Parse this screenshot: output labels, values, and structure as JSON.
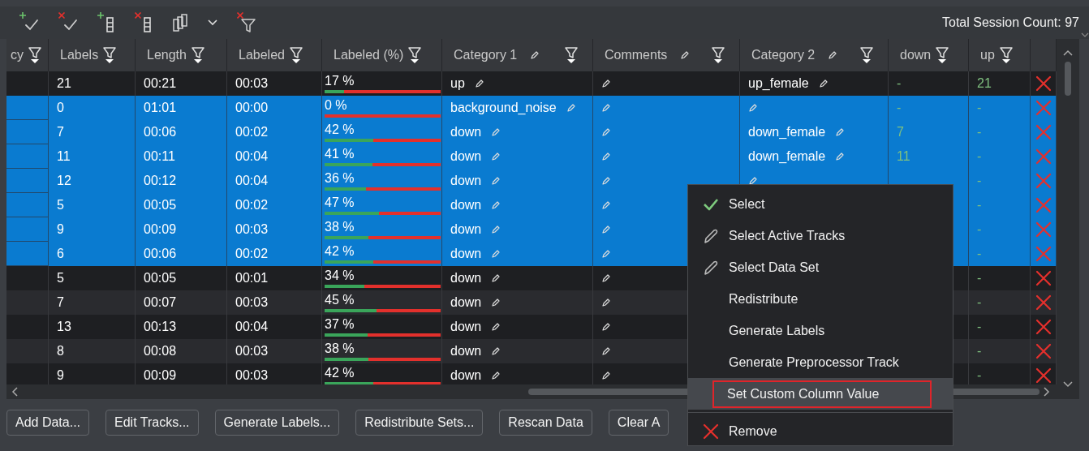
{
  "toolbar": {
    "session_count": "Total Session Count: 97"
  },
  "table": {
    "columns": [
      {
        "label": "cy",
        "kind": "text",
        "editable": false
      },
      {
        "label": "Labels",
        "kind": "text",
        "editable": false
      },
      {
        "label": "Length",
        "kind": "text",
        "editable": false
      },
      {
        "label": "Labeled",
        "kind": "text",
        "editable": false
      },
      {
        "label": "Labeled (%)",
        "kind": "progress",
        "editable": false
      },
      {
        "label": "Category 1",
        "kind": "text",
        "editable": true
      },
      {
        "label": "Comments",
        "kind": "text",
        "editable": true
      },
      {
        "label": "Category 2",
        "kind": "text",
        "editable": true
      },
      {
        "label": "down",
        "kind": "count",
        "editable": false
      },
      {
        "label": "up",
        "kind": "count",
        "editable": false
      }
    ],
    "rows": [
      {
        "selected": false,
        "cells": [
          null,
          "21",
          "00:21",
          "00:03",
          {
            "text": "17 %",
            "level": 0.17
          },
          "up",
          null,
          "up_female",
          "-",
          "21"
        ]
      },
      {
        "selected": true,
        "cells": [
          null,
          "0",
          "01:01",
          "00:00",
          {
            "text": "0 %",
            "level": 0
          },
          "background_noise",
          null,
          null,
          "-",
          "-"
        ]
      },
      {
        "selected": true,
        "cells": [
          null,
          "7",
          "00:06",
          "00:02",
          {
            "text": "42 %",
            "level": 0.42
          },
          "down",
          null,
          "down_female",
          "7",
          "-"
        ]
      },
      {
        "selected": true,
        "cells": [
          null,
          "11",
          "00:11",
          "00:04",
          {
            "text": "41 %",
            "level": 0.41
          },
          "down",
          null,
          "down_female",
          "11",
          "-"
        ]
      },
      {
        "selected": true,
        "cells": [
          null,
          "12",
          "00:12",
          "00:04",
          {
            "text": "36 %",
            "level": 0.36
          },
          "down",
          null,
          null,
          null,
          "-"
        ]
      },
      {
        "selected": true,
        "cells": [
          null,
          "5",
          "00:05",
          "00:02",
          {
            "text": "47 %",
            "level": 0.47
          },
          "down",
          null,
          null,
          null,
          "-"
        ]
      },
      {
        "selected": true,
        "cells": [
          null,
          "9",
          "00:09",
          "00:03",
          {
            "text": "38 %",
            "level": 0.38
          },
          "down",
          null,
          null,
          null,
          "-"
        ]
      },
      {
        "selected": true,
        "cells": [
          null,
          "6",
          "00:06",
          "00:02",
          {
            "text": "42 %",
            "level": 0.42
          },
          "down",
          null,
          null,
          null,
          "-"
        ]
      },
      {
        "selected": false,
        "cells": [
          null,
          "5",
          "00:05",
          "00:01",
          {
            "text": "34 %",
            "level": 0.34
          },
          "down",
          null,
          null,
          null,
          "-"
        ]
      },
      {
        "selected": false,
        "cells": [
          null,
          "7",
          "00:07",
          "00:03",
          {
            "text": "45 %",
            "level": 0.45
          },
          "down",
          null,
          null,
          null,
          "-"
        ]
      },
      {
        "selected": false,
        "cells": [
          null,
          "13",
          "00:13",
          "00:04",
          {
            "text": "37 %",
            "level": 0.37
          },
          "down",
          null,
          null,
          null,
          "-"
        ]
      },
      {
        "selected": false,
        "cells": [
          null,
          "8",
          "00:08",
          "00:03",
          {
            "text": "38 %",
            "level": 0.38
          },
          "down",
          null,
          null,
          null,
          "-"
        ]
      },
      {
        "selected": false,
        "cells": [
          null,
          "9",
          "00:09",
          "00:03",
          {
            "text": "42 %",
            "level": 0.42
          },
          "down",
          null,
          null,
          null,
          "-"
        ]
      }
    ]
  },
  "buttons": [
    "Add Data...",
    "Edit Tracks...",
    "Generate Labels...",
    "Redistribute Sets...",
    "Rescan Data",
    "Clear A"
  ],
  "context_menu": {
    "sections": [
      [
        {
          "label": "Select",
          "kind": "check",
          "selected": false
        },
        {
          "label": "Select Active Tracks",
          "kind": "pencil",
          "selected": false
        },
        {
          "label": "Select Data Set",
          "kind": "pencil",
          "selected": false
        },
        {
          "label": "Redistribute",
          "selected": false
        },
        {
          "label": "Generate Labels",
          "selected": false
        },
        {
          "label": "Generate Preprocessor Track",
          "selected": false
        },
        {
          "label": "Set Custom Column Value",
          "selected": true
        }
      ],
      [
        {
          "label": "Remove",
          "kind": "cross",
          "selected": false
        }
      ]
    ]
  }
}
